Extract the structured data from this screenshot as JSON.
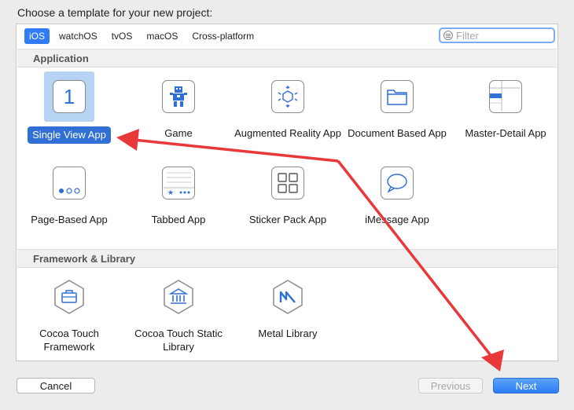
{
  "dialog": {
    "heading": "Choose a template for your new project:"
  },
  "platform_tabs": [
    {
      "label": "iOS",
      "active": true
    },
    {
      "label": "watchOS",
      "active": false
    },
    {
      "label": "tvOS",
      "active": false
    },
    {
      "label": "macOS",
      "active": false
    },
    {
      "label": "Cross-platform",
      "active": false
    }
  ],
  "filter": {
    "placeholder": "Filter",
    "value": ""
  },
  "sections": {
    "application": {
      "title": "Application",
      "items": [
        {
          "label": "Single View App",
          "icon": "single-view-icon",
          "glyph": "1",
          "selected": true
        },
        {
          "label": "Game",
          "icon": "game-icon",
          "selected": false
        },
        {
          "label": "Augmented Reality App",
          "icon": "augmented-reality-icon",
          "selected": false
        },
        {
          "label": "Document Based App",
          "icon": "document-icon",
          "selected": false
        },
        {
          "label": "Master-Detail App",
          "icon": "master-detail-icon",
          "selected": false
        },
        {
          "label": "Page-Based App",
          "icon": "page-based-icon",
          "selected": false
        },
        {
          "label": "Tabbed App",
          "icon": "tabbed-icon",
          "selected": false
        },
        {
          "label": "Sticker Pack App",
          "icon": "sticker-pack-icon",
          "selected": false
        },
        {
          "label": "iMessage App",
          "icon": "imessage-icon",
          "selected": false
        }
      ]
    },
    "framework": {
      "title": "Framework & Library",
      "items": [
        {
          "label": "Cocoa Touch Framework",
          "icon": "framework-icon"
        },
        {
          "label": "Cocoa Touch Static Library",
          "icon": "static-library-icon"
        },
        {
          "label": "Metal Library",
          "icon": "metal-icon"
        }
      ]
    }
  },
  "buttons": {
    "cancel": "Cancel",
    "previous": "Previous",
    "next": "Next"
  },
  "colors": {
    "accent": "#2f7cf6",
    "selection": "#2f6fd6",
    "annotation_arrow": "#e8383a"
  }
}
